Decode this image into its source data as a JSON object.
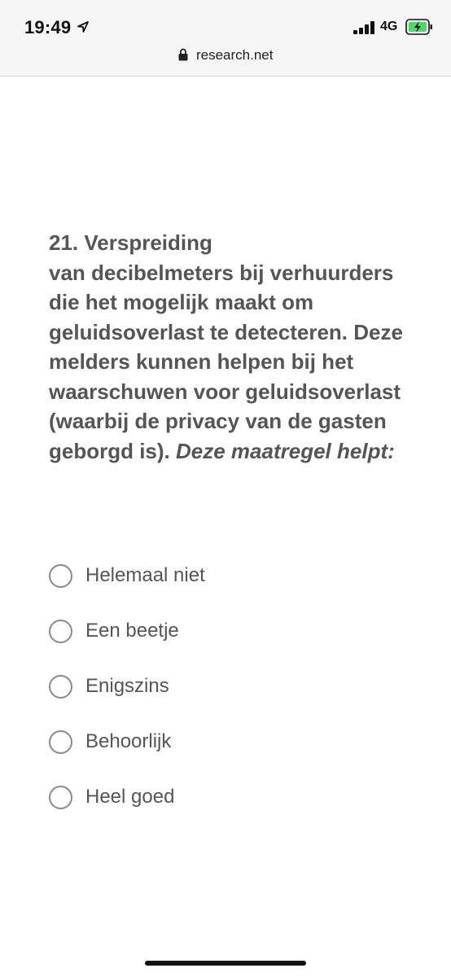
{
  "status": {
    "time": "19:49",
    "network": "4G",
    "location_icon": "location-arrow-icon",
    "signal_icon": "cellular-signal-icon",
    "battery_icon": "battery-charging-icon",
    "battery_color": "#4cd964"
  },
  "browser": {
    "url": "research.net",
    "lock_icon": "lock-icon"
  },
  "question": {
    "number": "21.",
    "title_line1": "Verspreiding",
    "body": "van decibelmeters bij verhuurders die het mogelijk maakt om geluidsoverlast te detecteren. Deze melders kunnen helpen bij het waarschuwen voor geluidsoverlast (waarbij de privacy van de gasten geborgd is).",
    "emphasis": "Deze maatregel helpt:"
  },
  "options": [
    {
      "label": "Helemaal niet"
    },
    {
      "label": "Een beetje"
    },
    {
      "label": "Enigszins"
    },
    {
      "label": "Behoorlijk"
    },
    {
      "label": "Heel goed"
    }
  ]
}
